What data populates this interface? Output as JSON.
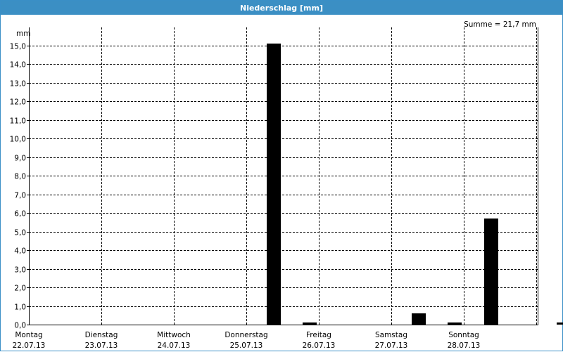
{
  "window": {
    "title": "Niederschlag [mm]"
  },
  "chart_data": {
    "type": "bar",
    "title": "Niederschlag [mm]",
    "unit_label": "mm",
    "summary": "Summe = 21,7 mm",
    "ylim": [
      0,
      16
    ],
    "yticks": [
      "0,0",
      "1,0",
      "2,0",
      "3,0",
      "4,0",
      "5,0",
      "6,0",
      "7,0",
      "8,0",
      "9,0",
      "10,0",
      "11,0",
      "12,0",
      "13,0",
      "14,0",
      "15,0"
    ],
    "grid": true,
    "days": [
      {
        "name": "Montag",
        "date": "22.07.13"
      },
      {
        "name": "Dienstag",
        "date": "23.07.13"
      },
      {
        "name": "Mittwoch",
        "date": "24.07.13"
      },
      {
        "name": "Donnerstag",
        "date": "25.07.13"
      },
      {
        "name": "Freitag",
        "date": "26.07.13"
      },
      {
        "name": "Samstag",
        "date": "27.07.13"
      },
      {
        "name": "Sonntag",
        "date": "28.07.13"
      }
    ],
    "interval": "12h",
    "values": [
      0,
      0,
      0,
      0,
      0,
      0,
      15.1,
      0.1,
      0,
      0,
      0.6,
      0.1,
      5.7,
      0,
      0.1
    ],
    "bar_color": "#000000"
  }
}
